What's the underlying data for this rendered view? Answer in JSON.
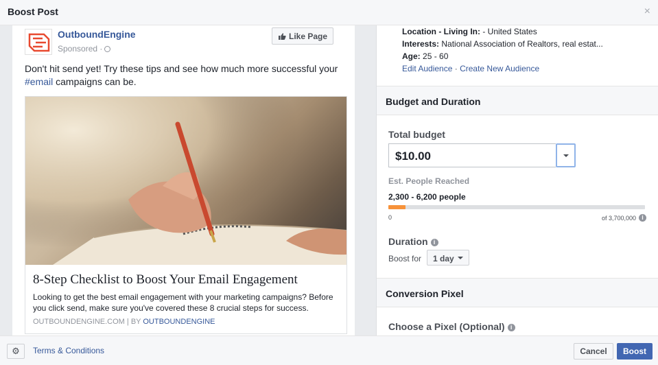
{
  "dialog": {
    "title": "Boost Post",
    "close_glyph": "×"
  },
  "post": {
    "page_name": "OutboundEngine",
    "sponsored": "Sponsored",
    "like_button": "Like Page",
    "text_before_hashtag": "Don't hit send yet! Try these tips and see how much more successful your ",
    "hashtag": "#email",
    "text_after_hashtag": " campaigns can be.",
    "card": {
      "title": "8-Step Checklist to Boost Your Email Engagement",
      "description": "Looking to get the best email engagement with your marketing campaigns? Before you click send, make sure you've covered these 8 crucial steps for success.",
      "domain": "OUTBOUNDENGINE.COM",
      "separator": "|",
      "by_prefix": "BY",
      "by_name": "OUTBOUNDENGINE"
    }
  },
  "audience": {
    "location_label": "Location - Living In:",
    "location_value": "- United States",
    "interests_label": "Interests:",
    "interests_value": "National Association of Realtors, real estat...",
    "age_label": "Age:",
    "age_value": "25 - 60",
    "edit_link": "Edit Audience",
    "separator": "·",
    "create_link": "Create New Audience"
  },
  "budget": {
    "section_title": "Budget and Duration",
    "total_label": "Total budget",
    "total_value": "$10.00",
    "est_label": "Est. People Reached",
    "est_value": "2,300 - 6,200 people",
    "reach_min": "0",
    "reach_max": "of 3,700,000",
    "reach_fill_fraction": 0.067,
    "duration_label": "Duration",
    "boost_for_label": "Boost for",
    "duration_value": "1 day"
  },
  "pixel": {
    "section_title": "Conversion Pixel",
    "choose_label": "Choose a Pixel (Optional)"
  },
  "footer": {
    "terms": "Terms & Conditions",
    "cancel": "Cancel",
    "boost": "Boost"
  },
  "colors": {
    "link": "#365899",
    "primary_button": "#4267b2",
    "reach_fill": "#f7923a",
    "logo_red": "#e8492f"
  }
}
